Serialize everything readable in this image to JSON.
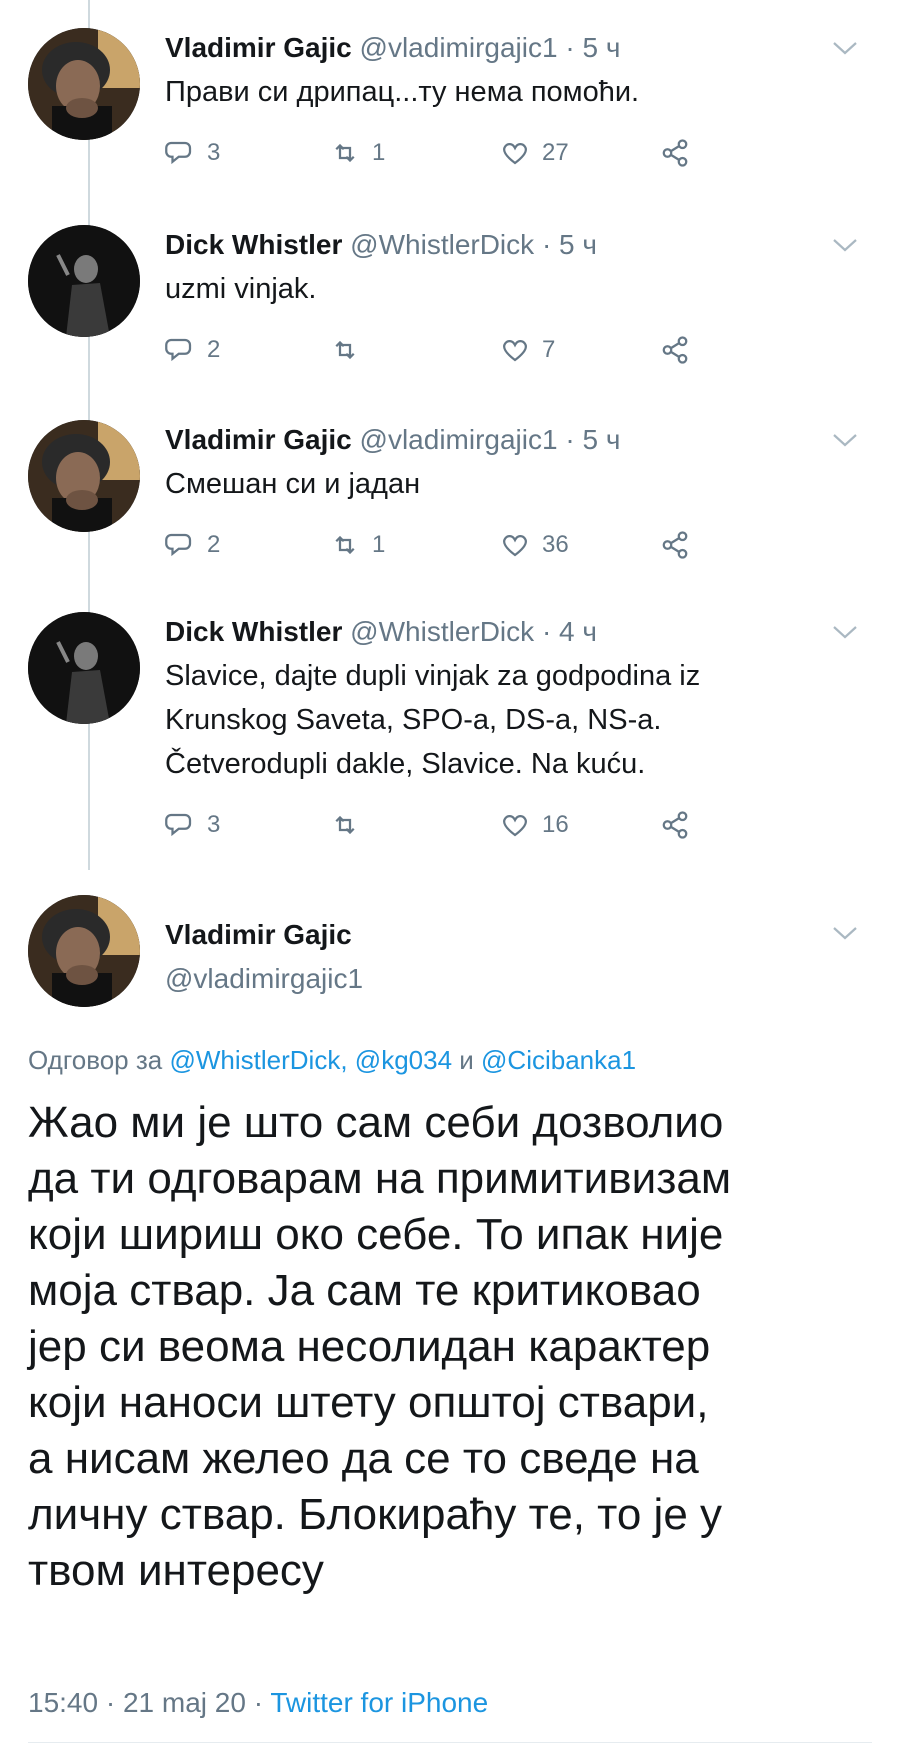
{
  "colors": {
    "accent": "#1b95e0",
    "secondary_text": "#657786",
    "primary_text": "#14171a",
    "thread_line": "#cfd9de"
  },
  "thread": [
    {
      "name": "Vladimir Gajic",
      "handle": "@vladimirgajic1",
      "dot": "·",
      "time": "5 ч",
      "text": "Прави си дрипац...ту нема помоћи.",
      "replies": "3",
      "retweets": "1",
      "likes": "27",
      "avatar": "vladimir-avatar"
    },
    {
      "name": "Dick Whistler",
      "handle": "@WhistlerDick",
      "dot": "·",
      "time": "5 ч",
      "text": "uzmi vinjak.",
      "replies": "2",
      "retweets": "",
      "likes": "7",
      "avatar": "dick-avatar"
    },
    {
      "name": "Vladimir Gajic",
      "handle": "@vladimirgajic1",
      "dot": "·",
      "time": "5 ч",
      "text": "Смешан си и јадан",
      "replies": "2",
      "retweets": "1",
      "likes": "36",
      "avatar": "vladimir-avatar"
    },
    {
      "name": "Dick Whistler",
      "handle": "@WhistlerDick",
      "dot": "·",
      "time": "4 ч",
      "text_lines": [
        "Slavice, dajte dupli vinjak za godpodina iz",
        "Krunskog Saveta, SPO-a, DS-a, NS-a.",
        "Četverodupli dakle, Slavice. Na kuću."
      ],
      "replies": "3",
      "retweets": "",
      "likes": "16",
      "avatar": "dick-avatar"
    }
  ],
  "main_tweet": {
    "name": "Vladimir Gajic",
    "handle": "@vladimirgajic1",
    "reply_prefix": "Одговор за",
    "reply_user1": "@WhistlerDick,",
    "reply_user2": "@kg034",
    "reply_and": "и",
    "reply_user3": "@Cicibanka1",
    "text_lines": [
      "Жао ми је што сам себи дозволио",
      "да ти одговарам на примитивизам",
      "који шириш око себе. То ипак није",
      "моја ствар. Ја сам те критиковао",
      "јер си веома несолидан карактер",
      "који наноси штету општој ствари,",
      "а нисам желео да се то сведе на",
      "личну ствар. Блокираћу те, то је у",
      "твом интересу"
    ],
    "timestamp": "15:40 · 21 maj 20",
    "footer_dot": "·",
    "source": "Twitter for iPhone"
  },
  "icons": {
    "reply": "reply-bubble-icon",
    "retweet": "retweet-icon",
    "like": "heart-icon",
    "share": "share-icon",
    "menu": "chevron-down-icon"
  }
}
